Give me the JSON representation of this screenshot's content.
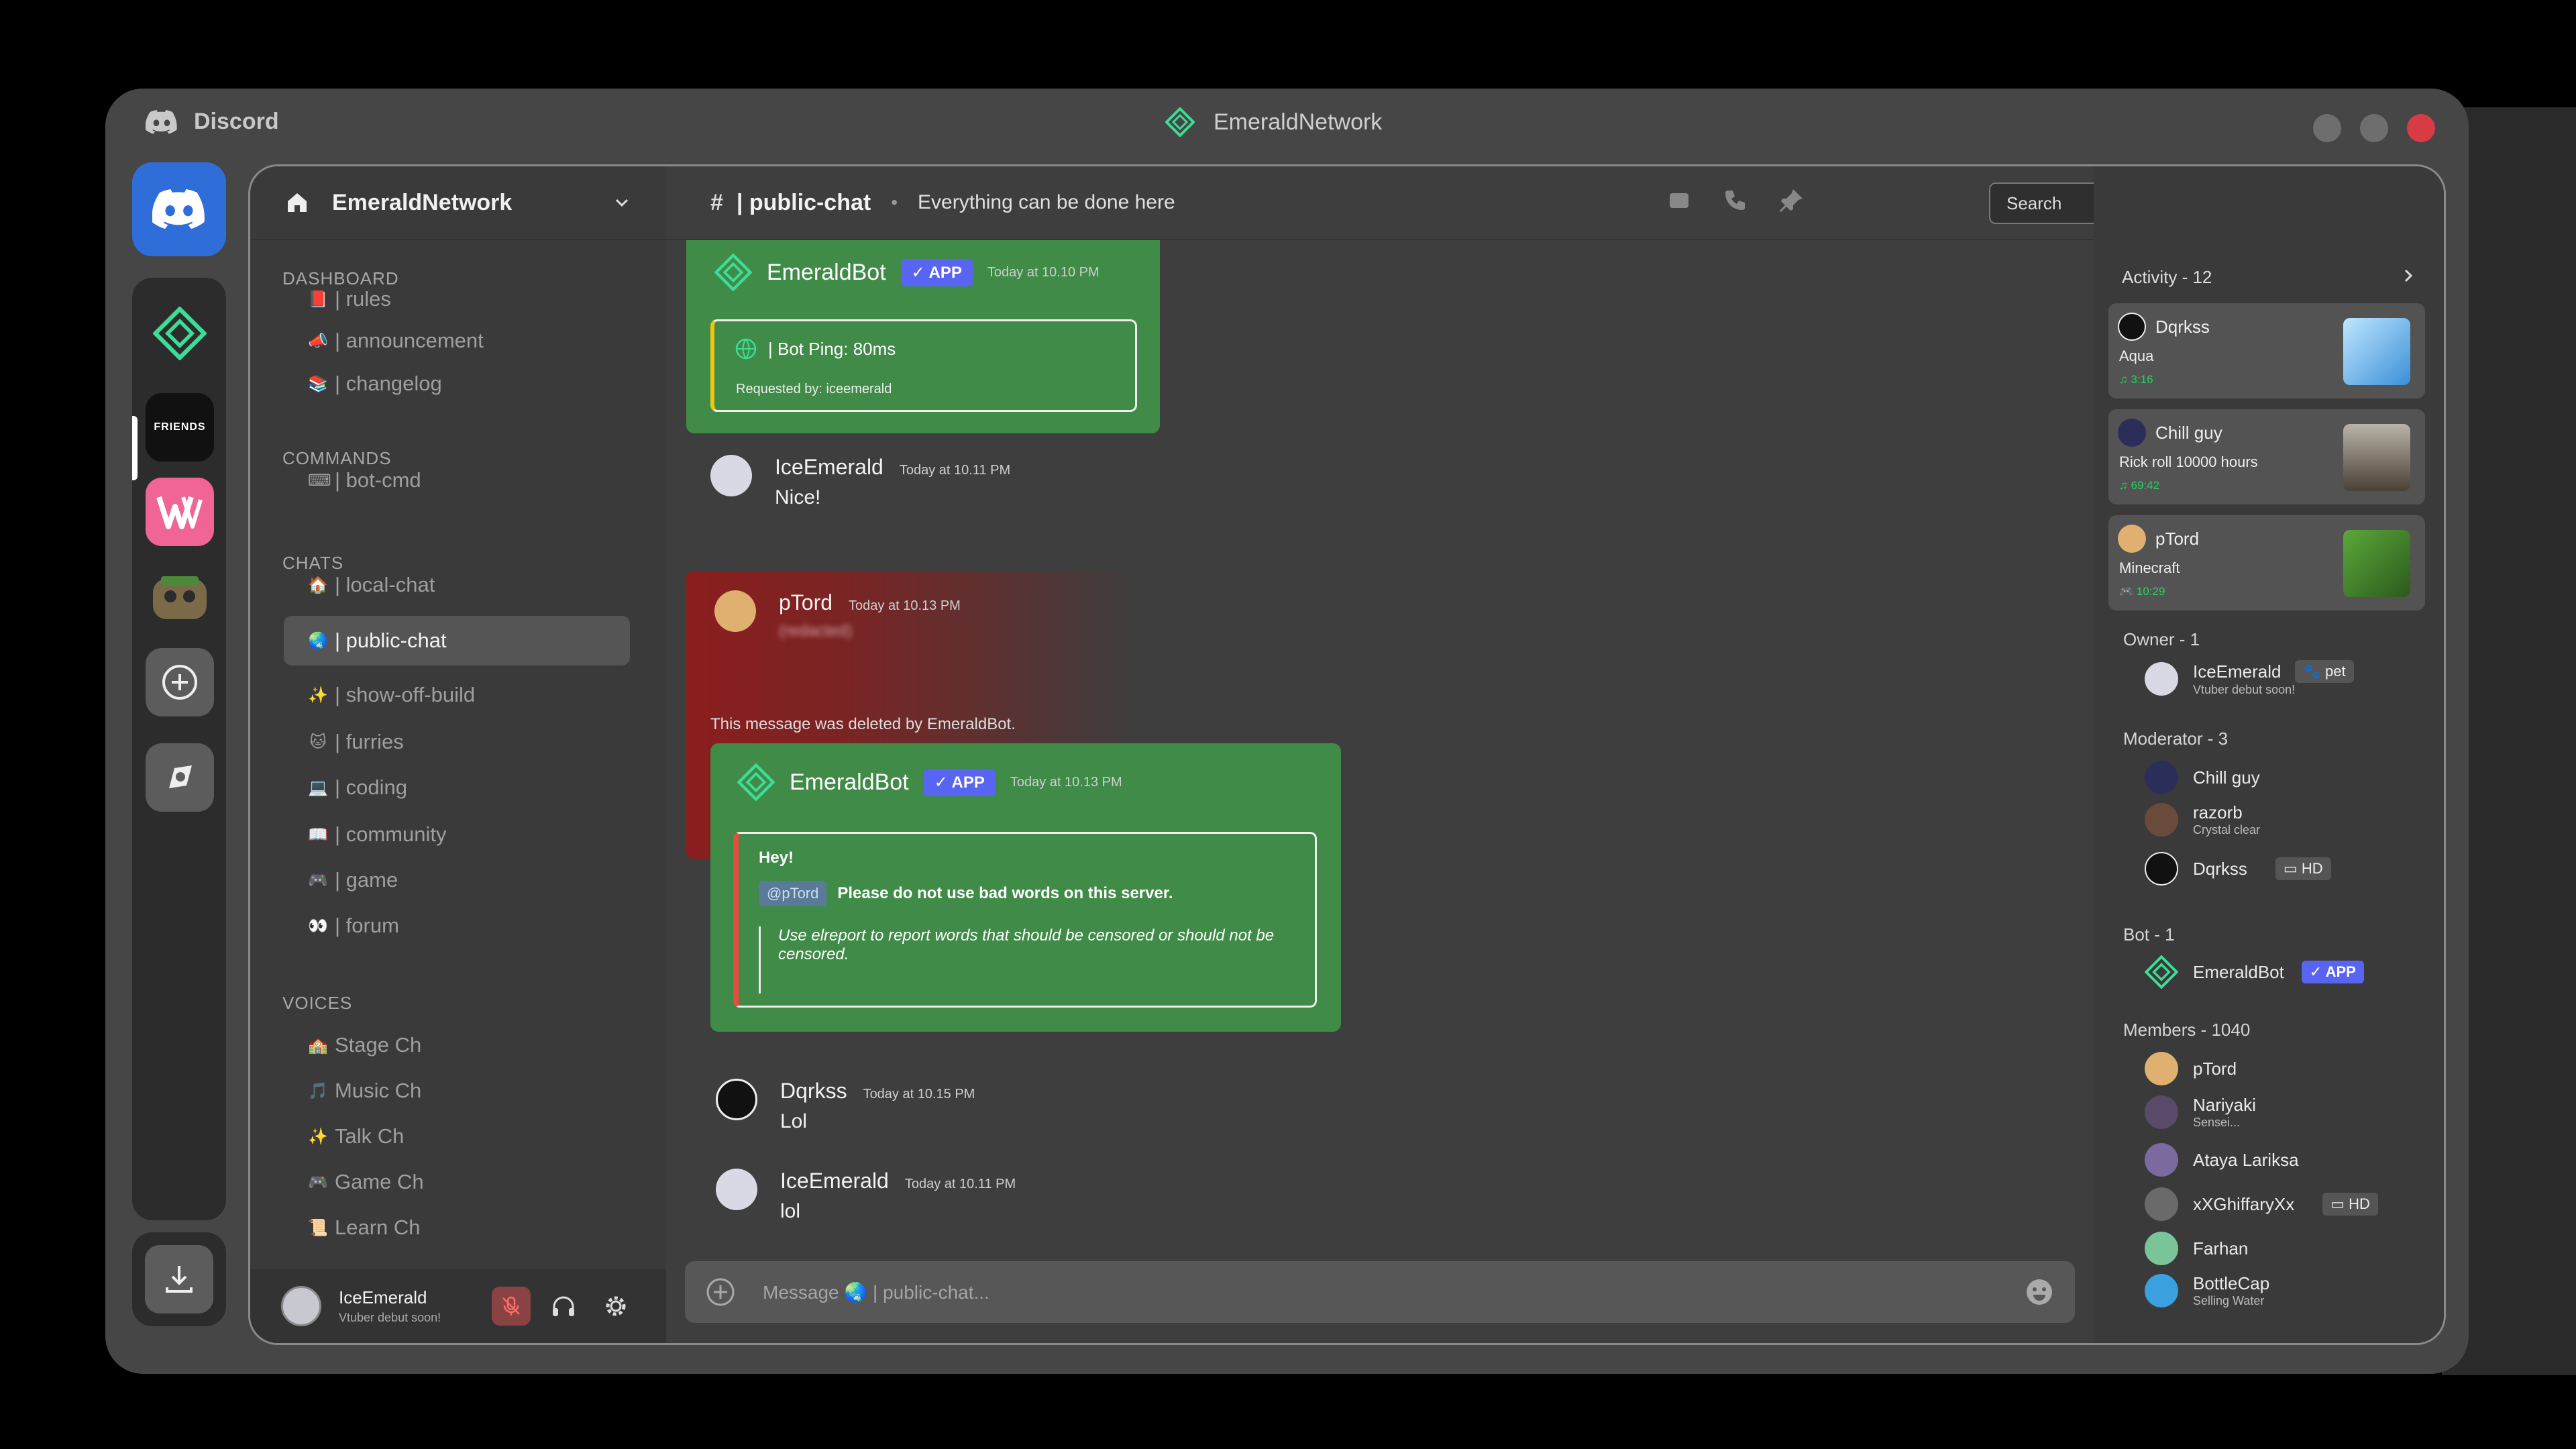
{
  "app": {
    "name": "Discord",
    "window_title": "EmeraldNetwork"
  },
  "server": {
    "name": "EmeraldNetwork"
  },
  "channels": {
    "categories": [
      "DASHBOARD",
      "COMMANDS",
      "CHATS",
      "VOICES"
    ],
    "dashboard": [
      {
        "emoji": "📕",
        "label": "| rules"
      },
      {
        "emoji": "📣",
        "label": "| announcement"
      },
      {
        "emoji": "📚",
        "label": "| changelog"
      }
    ],
    "commands": [
      {
        "emoji": "⌨",
        "label": "| bot-cmd"
      }
    ],
    "chats": [
      {
        "emoji": "🏠",
        "label": "| local-chat"
      },
      {
        "emoji": "🌏",
        "label": "| public-chat"
      },
      {
        "emoji": "✨",
        "label": "| show-off-build"
      },
      {
        "emoji": "🐱",
        "label": "| furries"
      },
      {
        "emoji": "💻",
        "label": "| coding"
      },
      {
        "emoji": "📖",
        "label": "| community"
      },
      {
        "emoji": "🎮",
        "label": "| game"
      },
      {
        "emoji": "👀",
        "label": "| forum"
      }
    ],
    "voices": [
      {
        "emoji": "🏫",
        "label": "Stage Ch"
      },
      {
        "emoji": "🎵",
        "label": "Music Ch"
      },
      {
        "emoji": "✨",
        "label": "Talk Ch"
      },
      {
        "emoji": "🎮",
        "label": "Game Ch"
      },
      {
        "emoji": "📜",
        "label": "Learn Ch"
      }
    ]
  },
  "user_bar": {
    "name": "IceEmerald",
    "status": "Vtuber debut soon!"
  },
  "chat": {
    "hash": "#",
    "channel": "| public-chat",
    "topic": "Everything can be done here",
    "search_placeholder": "Search",
    "composer_placeholder": "Message 🌏 | public-chat...",
    "deleted_note": "This message was deleted by EmeraldBot.",
    "messages": [
      {
        "type": "embed",
        "author": "EmeraldBot",
        "badge": "APP",
        "time": "Today at 10.10 PM",
        "title": "| Bot Ping: 80ms",
        "footer": "Requested by: iceemerald"
      },
      {
        "author": "IceEmerald",
        "time": "Today at 10.11 PM",
        "text": "Nice!"
      },
      {
        "author": "pTord",
        "time": "Today at 10.13 PM",
        "text": "(redacted)"
      },
      {
        "type": "embed",
        "author": "EmeraldBot",
        "badge": "APP",
        "time": "Today at 10.13 PM",
        "heading": "Hey!",
        "mention": "@pTord",
        "text": "Please do not use bad words on this server.",
        "note": "Use elreport to report words that should be censored or should not be censored."
      },
      {
        "author": "Dqrkss",
        "time": "Today at 10.15 PM",
        "text": "Lol"
      },
      {
        "author": "IceEmerald",
        "time": "Today at 10.11 PM",
        "text": "lol"
      }
    ]
  },
  "members": {
    "activity_title": "Activity - 12",
    "activities": [
      {
        "user": "Dqrkss",
        "activity": "Aqua",
        "time": "3:16"
      },
      {
        "user": "Chill guy",
        "activity": "Rick roll 10000 hours",
        "time": "69:42"
      },
      {
        "user": "pTord",
        "activity": "Minecraft",
        "time": "10:29"
      }
    ],
    "owner_title": "Owner - 1",
    "owner": {
      "name": "IceEmerald",
      "tag": "pet",
      "status": "Vtuber debut soon!"
    },
    "moderator_title": "Moderator - 3",
    "moderators": [
      {
        "name": "Chill guy"
      },
      {
        "name": "razorb",
        "status": "Crystal clear"
      },
      {
        "name": "Dqrkss",
        "tag": "HD"
      }
    ],
    "bot_title": "Bot - 1",
    "bot": {
      "name": "EmeraldBot",
      "tag": "APP"
    },
    "members_title": "Members - 1040",
    "list": [
      {
        "name": "pTord"
      },
      {
        "name": "Nariyaki",
        "status": "Sensei..."
      },
      {
        "name": "Ataya Lariksa"
      },
      {
        "name": "xXGhiffaryXx",
        "tag": "HD"
      },
      {
        "name": "Farhan"
      },
      {
        "name": "BottleCap",
        "status": "Selling Water"
      }
    ]
  },
  "colors": {
    "accent": "#5865f2",
    "green_embed": "#3f8b47",
    "red_highlight": "#8b1e1e",
    "emerald": "#3ddc97"
  }
}
